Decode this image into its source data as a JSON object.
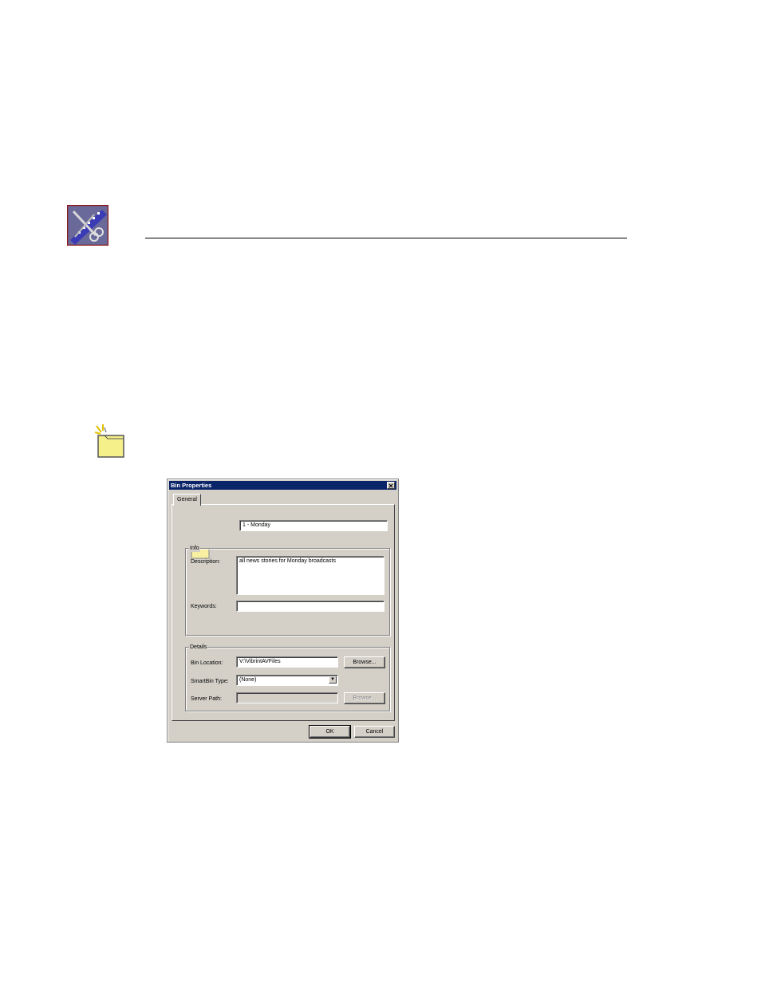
{
  "dialog": {
    "title": "Bin Properties",
    "close_glyph": "✕",
    "tab_general": "General",
    "bin_name": "1 - Monday",
    "info": {
      "group_title": "Info",
      "description_label": "Description:",
      "description_value": "all news stories for Monday broadcasts",
      "keywords_label": "Keywords:",
      "keywords_value": ""
    },
    "details": {
      "group_title": "Details",
      "bin_location_label": "Bin Location:",
      "bin_location_value": "V:\\VibrintAVFiles",
      "browse_label": "Browse...",
      "smartbin_type_label": "SmartBin Type:",
      "smartbin_type_value": "(None)",
      "server_path_label": "Server Path:",
      "server_path_value": "",
      "server_browse_label": "Browse..."
    },
    "ok_label": "OK",
    "cancel_label": "Cancel"
  },
  "icons": {
    "logo": "film-scissors-icon",
    "note": "note-icon",
    "folder": "folder-icon"
  },
  "colors": {
    "titlebar": "#0a246a",
    "dialog_face": "#d4d0c8",
    "folder_fill": "#f8f0a0"
  }
}
